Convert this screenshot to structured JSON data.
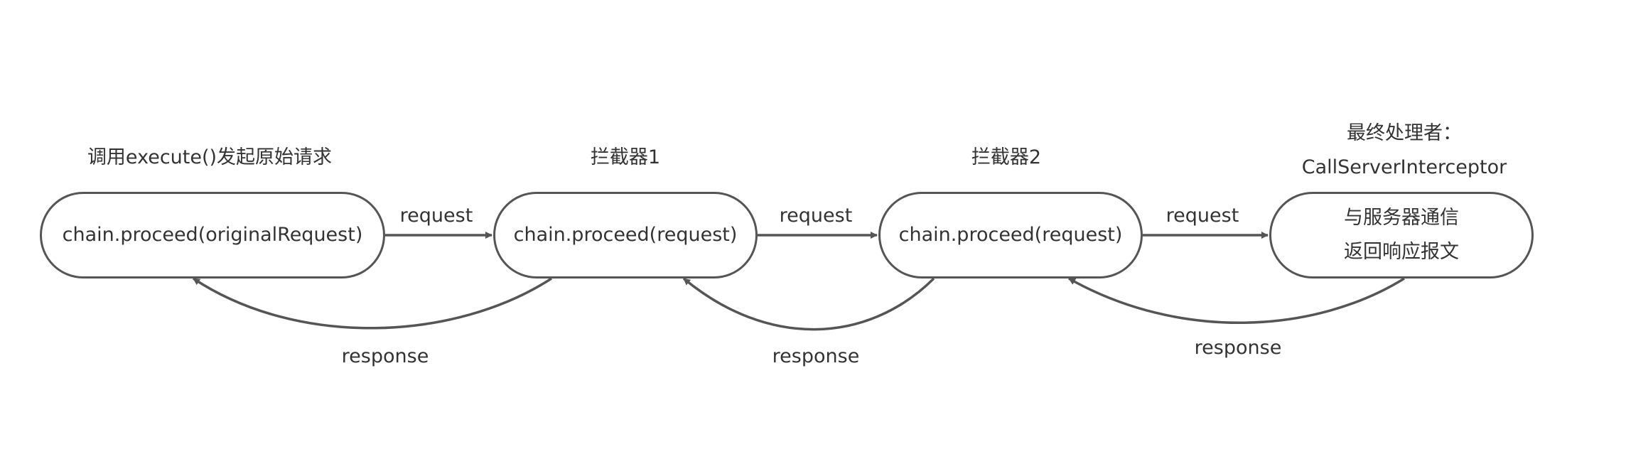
{
  "diagram": {
    "stroke_color": "#555555",
    "text_color": "#333333",
    "nodes": [
      {
        "id": "caller",
        "title": "调用execute()发起原始请求",
        "title_lines": [],
        "lines": [
          "chain.proceed(originalRequest)"
        ]
      },
      {
        "id": "interceptor1",
        "title": "拦截器1",
        "title_lines": [],
        "lines": [
          "chain.proceed(request)"
        ]
      },
      {
        "id": "interceptor2",
        "title": "拦截器2",
        "title_lines": [],
        "lines": [
          "chain.proceed(request)"
        ]
      },
      {
        "id": "server",
        "title": "",
        "title_lines": [
          "最终处理者：",
          "CallServerInterceptor"
        ],
        "lines": [
          "与服务器通信",
          "返回响应报文"
        ]
      }
    ],
    "edges": [
      {
        "from": "caller",
        "to": "interceptor1",
        "label": "request",
        "kind": "request"
      },
      {
        "from": "interceptor1",
        "to": "interceptor2",
        "label": "request",
        "kind": "request"
      },
      {
        "from": "interceptor2",
        "to": "server",
        "label": "request",
        "kind": "request"
      },
      {
        "from": "interceptor1",
        "to": "caller",
        "label": "response",
        "kind": "response"
      },
      {
        "from": "interceptor2",
        "to": "interceptor1",
        "label": "response",
        "kind": "response"
      },
      {
        "from": "server",
        "to": "interceptor2",
        "label": "response",
        "kind": "response"
      }
    ]
  }
}
